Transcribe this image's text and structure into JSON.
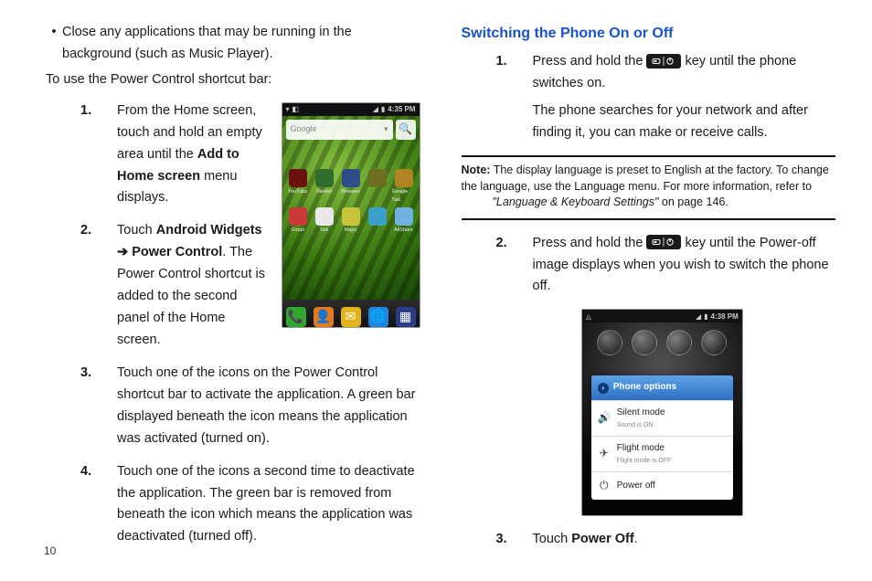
{
  "page_number": "10",
  "left_col": {
    "bullet": "Close any applications that may be running in the background (such as Music Player).",
    "intro": "To use the Power Control shortcut bar:",
    "step1": {
      "prefix": "From the Home screen, touch and hold an empty area until the ",
      "bold": "Add to Home screen",
      "suffix": " menu displays."
    },
    "step2": {
      "prefix": "Touch ",
      "bold1": "Android Widgets",
      "arrow": " ➔ ",
      "bold2": "Power Control",
      "suffix": ". The Power Control shortcut is added to the second panel of the Home screen."
    },
    "step3": "Touch one of the icons on the Power Control shortcut bar to activate the application. A green bar displayed beneath the icon means the application was activated (turned on).",
    "step4": "Touch one of the icons a second time to deactivate the application. The green bar is removed from beneath the icon which means the application was deactivated (turned off)."
  },
  "right_col": {
    "heading": "Switching the Phone On or Off",
    "step1": {
      "prefix": "Press and hold the ",
      "suffix": " key until the phone switches on.",
      "para2": "The phone searches for your network and after finding it, you can make or receive calls."
    },
    "note": {
      "lead": "Note:",
      "body_prefix": " The display language is preset to English at the factory.  To change the language, use the Language menu. For more information, refer to ",
      "italic": "\"Language & Keyboard Settings\"",
      "body_suffix": "  on page 146."
    },
    "step2": {
      "prefix": "Press and hold the ",
      "suffix": " key until the Power-off image displays when you wish to switch the phone off."
    },
    "step3": {
      "prefix": "Touch ",
      "bold": "Power Off",
      "suffix": "."
    }
  },
  "phone_home": {
    "time": "4:35 PM",
    "search_brand": "Google",
    "apps_row1": [
      "YouTube",
      "Market",
      "Browser",
      "",
      "Google Talk"
    ],
    "apps_row2": [
      "Gmail",
      "Talk",
      "Maps",
      "",
      "AllShare"
    ],
    "app_colors_row1": [
      "#6b0f0f",
      "#2f6e2f",
      "#2e4e8a",
      "#6e6e22",
      "#b08420"
    ],
    "app_colors_row2": [
      "#c93a3a",
      "#e8e8e8",
      "#c7c33a",
      "#3aa0c9",
      "#6fb2e0"
    ]
  },
  "phone_options": {
    "time": "4:38 PM",
    "title": "Phone options",
    "opt1_title": "Silent mode",
    "opt1_sub": "Sound is ON",
    "opt2_title": "Flight mode",
    "opt2_sub": "Flight mode is OFF",
    "opt3_title": "Power off"
  }
}
